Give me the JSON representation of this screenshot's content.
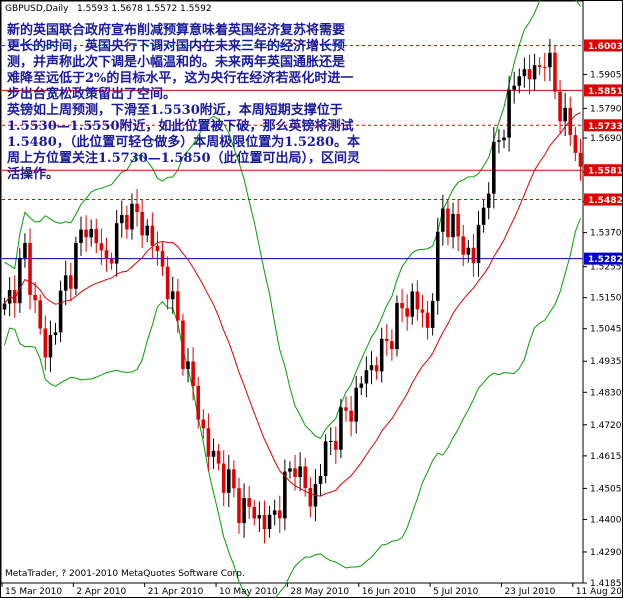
{
  "header": {
    "symbol": "GBPUSD,Daily",
    "quote": "1.5593 1.5678 1.5572 1.5592"
  },
  "annotation": {
    "paragraphs": [
      "新的英国联合政府宣布削减预算意味着英国经济复苏将需要更长的时间，英国央行下调对国内在未来三年的经济增长预测，并声称此次下调是小幅温和的。未来两年英国通胀还是难降至远低于2%的目标水平，这为央行在经济若恶化时进一步出台宽松政策留出了空间。",
      "英镑如上周预测，下滑至1.5530附近，本周短期支撑位于1.5530—1.5550附近，如此位置被下破，那么英镑将测试1.5480，（此位置可轻仓做多）本周极限位置为1.5280。本周上方位置关注1.5730—1.5850（此位置可出局），区间灵活操作。"
    ],
    "lines": [
      "新的英国联合政府宣布削减预算意味着英国经济复苏将需要",
      "更长的时间，英国央行下调对国内在未来三年的经济增长预",
      "测，并声称此次下调是小幅温和的。未来两年英国通胀还是",
      "难降至远低于2%的目标水平，这为央行在经济若恶化时进一",
      "步出台宽松政策留出了空间。",
      "英镑如上周预测，下滑至1.5530附近，本周短期支撑位于",
      "1.5530—1.5550附近，如此位置被下破，那么英镑将测试",
      "1.5480，（此位置可轻仓做多）本周极限位置为1.5280。本",
      "周上方位置关注1.5730—1.5850（此位置可出局），区间灵",
      "活操作。"
    ]
  },
  "copyright": "MetaTrader, ? 2001-2010 MetaQuotes Software Corp.",
  "chart_data": {
    "type": "candlestick",
    "title": "GBPUSD,Daily",
    "ylim": [
      1.4185,
      1.615
    ],
    "y_ticks": [
      "1.5905",
      "1.5790",
      "1.5690",
      "1.5575",
      "1.5475",
      "1.5370",
      "1.5255",
      "1.5150",
      "1.5045",
      "1.4935",
      "1.4830",
      "1.4720",
      "1.4615",
      "1.4505",
      "1.4400",
      "1.4290",
      "1.4185"
    ],
    "x_ticks": [
      "15 Mar 2010",
      "2 Apr 2010",
      "21 Apr 2010",
      "10 May 2010",
      "28 May 2010",
      "16 Jun 2010",
      "5 Jul 2010",
      "23 Jul 2010",
      "11 Aug 2010"
    ],
    "x_tick_bar_index": [
      0,
      14,
      28,
      42,
      56,
      70,
      84,
      98,
      112
    ],
    "price_levels": [
      {
        "value": 1.6003,
        "label": "1.6003",
        "color": "#e00000",
        "style": "dashed"
      },
      {
        "value": 1.5851,
        "label": "1.5851",
        "color": "#e00000",
        "style": "solid"
      },
      {
        "value": 1.5733,
        "label": "1.5733",
        "color": "#e00000",
        "style": "dashed"
      },
      {
        "value": 1.5581,
        "label": "1.5581",
        "color": "#e00000",
        "style": "solid"
      },
      {
        "value": 1.5482,
        "label": "1.5482",
        "color": "#e00000",
        "style": "dashed"
      },
      {
        "value": 1.5282,
        "label": "1.5282",
        "color": "#0000d0",
        "style": "solid"
      }
    ],
    "close_anchors": [
      [
        0,
        1.51
      ],
      [
        4,
        1.53
      ],
      [
        8,
        1.495
      ],
      [
        12,
        1.52
      ],
      [
        16,
        1.54
      ],
      [
        20,
        1.527
      ],
      [
        24,
        1.545
      ],
      [
        28,
        1.538
      ],
      [
        32,
        1.52
      ],
      [
        36,
        1.49
      ],
      [
        40,
        1.463
      ],
      [
        42,
        1.458
      ],
      [
        44,
        1.452
      ],
      [
        46,
        1.445
      ],
      [
        49,
        1.442
      ],
      [
        52,
        1.438
      ],
      [
        55,
        1.451
      ],
      [
        57,
        1.46
      ],
      [
        60,
        1.445
      ],
      [
        62,
        1.458
      ],
      [
        65,
        1.47
      ],
      [
        68,
        1.478
      ],
      [
        71,
        1.49
      ],
      [
        74,
        1.496
      ],
      [
        77,
        1.508
      ],
      [
        80,
        1.515
      ],
      [
        83,
        1.505
      ],
      [
        86,
        1.545
      ],
      [
        89,
        1.535
      ],
      [
        92,
        1.528
      ],
      [
        95,
        1.555
      ],
      [
        98,
        1.575
      ],
      [
        101,
        1.592
      ],
      [
        104,
        1.59
      ],
      [
        106,
        1.598
      ],
      [
        108,
        1.585
      ],
      [
        110,
        1.575
      ],
      [
        112,
        1.565
      ],
      [
        113,
        1.559
      ]
    ],
    "bar_count": 114,
    "colors": {
      "bull": "#000000",
      "bear": "#e00000",
      "ma": "#e00000",
      "bands": "#00a000",
      "grid_levels_label_bg_red": "#e00000",
      "grid_levels_label_bg_blue": "#0000d0"
    },
    "indicators": [
      "Moving Average (red)",
      "Bollinger Bands (green)"
    ]
  }
}
